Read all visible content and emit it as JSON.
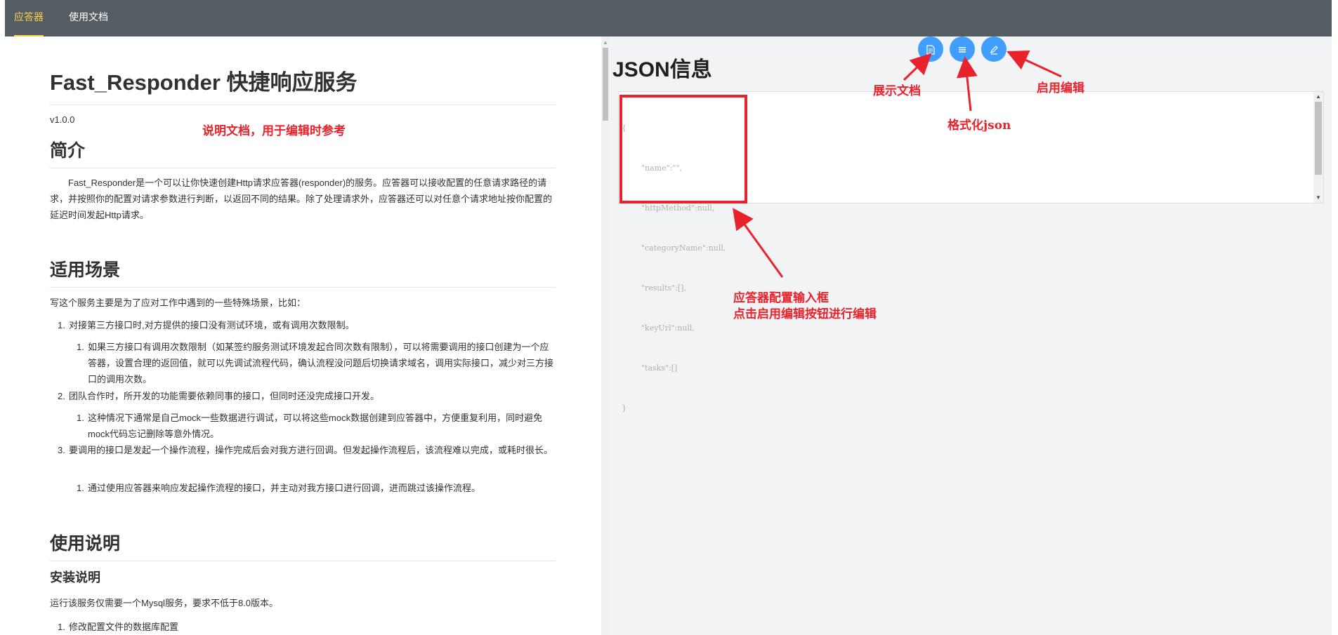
{
  "nav": {
    "tabs": [
      {
        "label": "应答器"
      },
      {
        "label": "使用文档"
      }
    ]
  },
  "doc": {
    "title": "Fast_Responder 快捷响应服务",
    "version": "v1.0.0",
    "intro_heading": "简介",
    "intro_text": "　　Fast_Responder是一个可以让你快速创建Http请求应答器(responder)的服务。应答器可以接收配置的任意请求路径的请求，并按照你的配置对请求参数进行判断，以返回不同的结果。除了处理请求外，应答器还可以对任意个请求地址按你配置的延迟时间发起Http请求。",
    "scenarios_heading": "适用场景",
    "scenarios_lead": "写这个服务主要是为了应对工作中遇到的一些特殊场景，比如：",
    "items": [
      {
        "num": "1.",
        "text": "对接第三方接口时,对方提供的接口没有测试环境，或有调用次数限制。"
      },
      {
        "num": "1.",
        "text": "如果三方接口有调用次数限制（如某签约服务测试环境发起合同次数有限制），可以将需要调用的接口创建为一个应答器，设置合理的返回值，就可以先调试流程代码，确认流程没问题后切换请求域名，调用实际接口，减少对三方接口的调用次数。"
      },
      {
        "num": "2.",
        "text": "团队合作时，所开发的功能需要依赖同事的接口，但同时还没完成接口开发。"
      },
      {
        "num": "1.",
        "text": "这种情况下通常是自己mock一些数据进行调试，可以将这些mock数据创建到应答器中，方便重复利用，同时避免mock代码忘记删除等意外情况。"
      },
      {
        "num": "3.",
        "text": "要调用的接口是发起一个操作流程，操作完成后会对我方进行回调。但发起操作流程后，该流程难以完成，或耗时很长。"
      },
      {
        "num": "1.",
        "text": "通过使用应答器来响应发起操作流程的接口，并主动对我方接口进行回调，进而跳过该操作流程。"
      }
    ],
    "usage_heading": "使用说明",
    "install_heading": "安装说明",
    "install_text": "运行该服务仅需要一个Mysql服务，要求不低于8.0版本。",
    "install_item": {
      "num": "1.",
      "text": "修改配置文件的数据库配置"
    }
  },
  "json_panel": {
    "title": "JSON信息",
    "buttons": {
      "doc": "展示文档",
      "format": "格式化json",
      "edit": "启用编辑"
    },
    "editor_lines": [
      "{",
      "        \"name\":\"\",",
      "        \"httpMethod\":null,",
      "        \"categoryName\":null,",
      "        \"results\":[],",
      "        \"keyUrl\":null,",
      "        \"tasks\":[]",
      "}"
    ]
  },
  "annotations": {
    "doc_note": "说明文档，用于编辑时参考",
    "show_doc": "展示文档",
    "format_json": "格式化json",
    "enable_edit": "启用编辑",
    "input_box_line1": "应答器配置输入框",
    "input_box_line2": "点击启用编辑按钮进行编辑"
  },
  "colors": {
    "topbar": "#545c64",
    "active_tab": "#ffd04b",
    "button": "#409eff",
    "annotation": "#e8232b"
  },
  "icons": {
    "doc": "document-icon",
    "format": "list-icon",
    "edit": "edit-icon"
  }
}
